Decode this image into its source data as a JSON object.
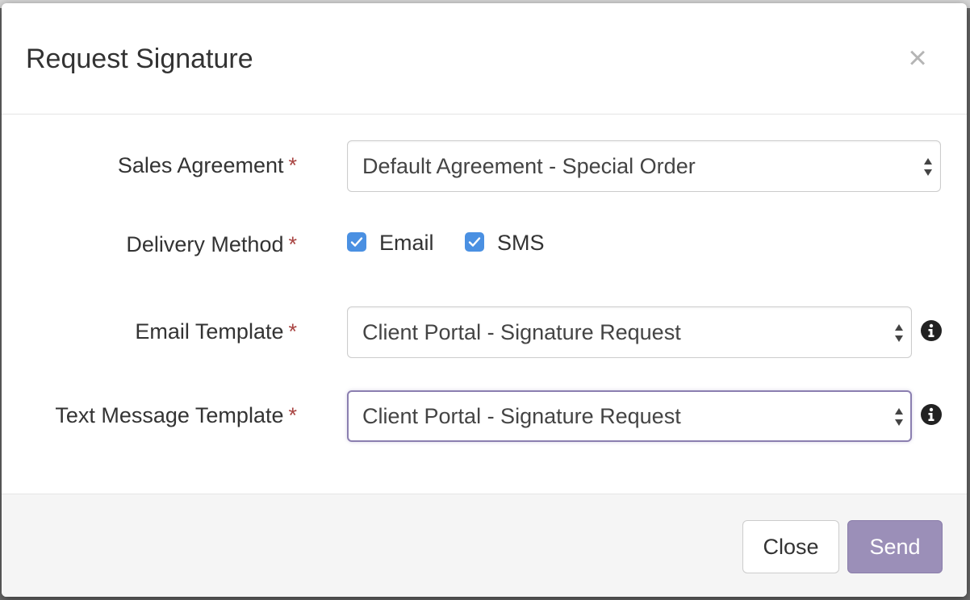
{
  "modal": {
    "title": "Request Signature",
    "close_glyph": "×"
  },
  "form": {
    "sales_agreement": {
      "label": "Sales Agreement",
      "required_marker": "*",
      "value": "Default Agreement - Special Order"
    },
    "delivery_method": {
      "label": "Delivery Method",
      "required_marker": "*",
      "options": [
        {
          "label": "Email",
          "checked": true
        },
        {
          "label": "SMS",
          "checked": true
        }
      ]
    },
    "email_template": {
      "label": "Email Template",
      "required_marker": "*",
      "value": "Client Portal - Signature Request",
      "icon": "info-icon"
    },
    "text_message_template": {
      "label": "Text Message Template",
      "required_marker": "*",
      "value": "Client Portal - Signature Request",
      "icon": "info-icon"
    }
  },
  "footer": {
    "close_label": "Close",
    "send_label": "Send"
  },
  "colors": {
    "required": "#a94442",
    "checkbox": "#4a90e2",
    "primary_button": "#9b8fb8",
    "focus_border": "#8b7fb0"
  }
}
